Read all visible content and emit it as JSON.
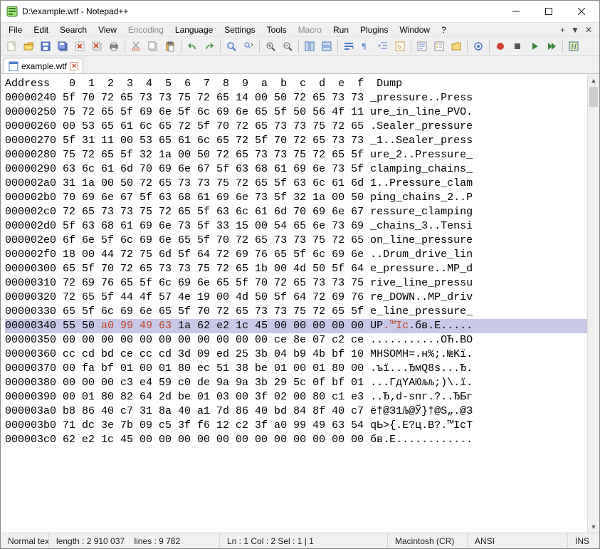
{
  "window": {
    "title": "D:\\example.wtf - Notepad++"
  },
  "menu": {
    "items": [
      "File",
      "Edit",
      "Search",
      "View",
      "Encoding",
      "Language",
      "Settings",
      "Tools",
      "Macro",
      "Run",
      "Plugins",
      "Window",
      "?"
    ],
    "disabled": [
      "Encoding",
      "Macro"
    ]
  },
  "tab": {
    "label": "example.wtf",
    "close": "×"
  },
  "hex": {
    "header": "Address   0  1  2  3  4  5  6  7  8  9  a  b  c  d  e  f  Dump",
    "rows": [
      {
        "addr": "00000240",
        "bytes": "5f 70 72 65 73 73 75 72 65 14 00 50 72 65 73 73",
        "dump": "_pressure..Press"
      },
      {
        "addr": "00000250",
        "bytes": "75 72 65 5f 69 6e 5f 6c 69 6e 65 5f 50 56 4f 11",
        "dump": "ure_in_line_PVO."
      },
      {
        "addr": "00000260",
        "bytes": "00 53 65 61 6c 65 72 5f 70 72 65 73 73 75 72 65",
        "dump": ".Sealer_pressure"
      },
      {
        "addr": "00000270",
        "bytes": "5f 31 11 00 53 65 61 6c 65 72 5f 70 72 65 73 73",
        "dump": "_1..Sealer_press"
      },
      {
        "addr": "00000280",
        "bytes": "75 72 65 5f 32 1a 00 50 72 65 73 73 75 72 65 5f",
        "dump": "ure_2..Pressure_"
      },
      {
        "addr": "00000290",
        "bytes": "63 6c 61 6d 70 69 6e 67 5f 63 68 61 69 6e 73 5f",
        "dump": "clamping_chains_"
      },
      {
        "addr": "000002a0",
        "bytes": "31 1a 00 50 72 65 73 73 75 72 65 5f 63 6c 61 6d",
        "dump": "1..Pressure_clam"
      },
      {
        "addr": "000002b0",
        "bytes": "70 69 6e 67 5f 63 68 61 69 6e 73 5f 32 1a 00 50",
        "dump": "ping_chains_2..P"
      },
      {
        "addr": "000002c0",
        "bytes": "72 65 73 73 75 72 65 5f 63 6c 61 6d 70 69 6e 67",
        "dump": "ressure_clamping"
      },
      {
        "addr": "000002d0",
        "bytes": "5f 63 68 61 69 6e 73 5f 33 15 00 54 65 6e 73 69",
        "dump": "_chains_3..Tensi"
      },
      {
        "addr": "000002e0",
        "bytes": "6f 6e 5f 6c 69 6e 65 5f 70 72 65 73 73 75 72 65",
        "dump": "on_line_pressure"
      },
      {
        "addr": "000002f0",
        "bytes": "18 00 44 72 75 6d 5f 64 72 69 76 65 5f 6c 69 6e",
        "dump": "..Drum_drive_lin"
      },
      {
        "addr": "00000300",
        "bytes": "65 5f 70 72 65 73 73 75 72 65 1b 00 4d 50 5f 64",
        "dump": "e_pressure..MP_d"
      },
      {
        "addr": "00000310",
        "bytes": "72 69 76 65 5f 6c 69 6e 65 5f 70 72 65 73 73 75",
        "dump": "rive_line_pressu"
      },
      {
        "addr": "00000320",
        "bytes": "72 65 5f 44 4f 57 4e 19 00 4d 50 5f 64 72 69 76",
        "dump": "re_DOWN..MP_driv"
      },
      {
        "addr": "00000330",
        "bytes": "65 5f 6c 69 6e 65 5f 70 72 65 73 73 75 72 65 5f",
        "dump": "e_line_pressure_"
      },
      {
        "addr": "00000340",
        "pre": "55 50 ",
        "sel": "a0 99 49 63",
        "post": " 1a 62 e2 1c 45 00 00 00 00 00",
        "dump_pre": "UP",
        "dump_sel": ".™Ic",
        "dump_post": ".бв.E.....",
        "hl": true
      },
      {
        "addr": "00000350",
        "bytes": "00 00 00 00 00 00 00 00 00 00 00 ce 8e 07 c2 ce",
        "dump": "...........ОЋ.ВО"
      },
      {
        "addr": "00000360",
        "bytes": "cc cd bd ce cc cd 3d 09 ed 25 3b 04 b9 4b bf 10",
        "dump": "МНЅОМН=.н%;.№Kї."
      },
      {
        "addr": "00000370",
        "bytes": "00 fa bf 01 00 01 80 ec 51 38 be 01 00 01 80 00",
        "dump": ".ъї...ЂмQ8s...Ђ."
      },
      {
        "addr": "00000380",
        "bytes": "00 00 00 c3 e4 59 c0 de 9a 9a 3b 29 5c 0f bf 01",
        "dump": "...ГдYАЮљљ;)\\.ї."
      },
      {
        "addr": "00000390",
        "bytes": "00 01 80 82 64 2d be 01 03 00 3f 02 00 80 c1 e3",
        "dump": "..Ђ‚d-ѕпг.?..ЂБг"
      },
      {
        "addr": "000003a0",
        "bytes": "b8 86 40 c7 31 8a 40 a1 7d 86 40 bd 84 8f 40 c7",
        "dump": "ё†@З1Љ@Ў}†@Ѕ„.@З"
      },
      {
        "addr": "000003b0",
        "bytes": "71 dc 3e 7b 09 c5 3f f6 12 c2 3f a0 99 49 63 54",
        "dump": "qЬ>{.Е?ц.В?.™IсT"
      },
      {
        "addr": "000003c0",
        "bytes": "62 e2 1c 45 00 00 00 00 00 00 00 00 00 00 00 00",
        "dump": "бв.E............"
      }
    ]
  },
  "status": {
    "filetype": "Normal text file",
    "length_label": "length : 2 910 037",
    "lines_label": "lines : 9 782",
    "pos": "Ln : 1    Col : 2    Sel : 1 | 1",
    "eol": "Macintosh (CR)",
    "enc": "ANSI",
    "ins": "INS"
  },
  "icons": {
    "toolbar": [
      "new",
      "open",
      "save",
      "save-all",
      "close",
      "close-all",
      "print",
      "|",
      "cut",
      "copy",
      "paste",
      "|",
      "undo",
      "redo",
      "|",
      "find",
      "replace",
      "|",
      "zoom-in",
      "zoom-out",
      "|",
      "sync-v",
      "sync-h",
      "|",
      "wrap",
      "all-chars",
      "indent",
      "lang",
      "|",
      "doc-map",
      "func-list",
      "folder",
      "|",
      "monitor",
      "|",
      "record",
      "stop",
      "play",
      "play-multi",
      "|",
      "highlight"
    ]
  }
}
